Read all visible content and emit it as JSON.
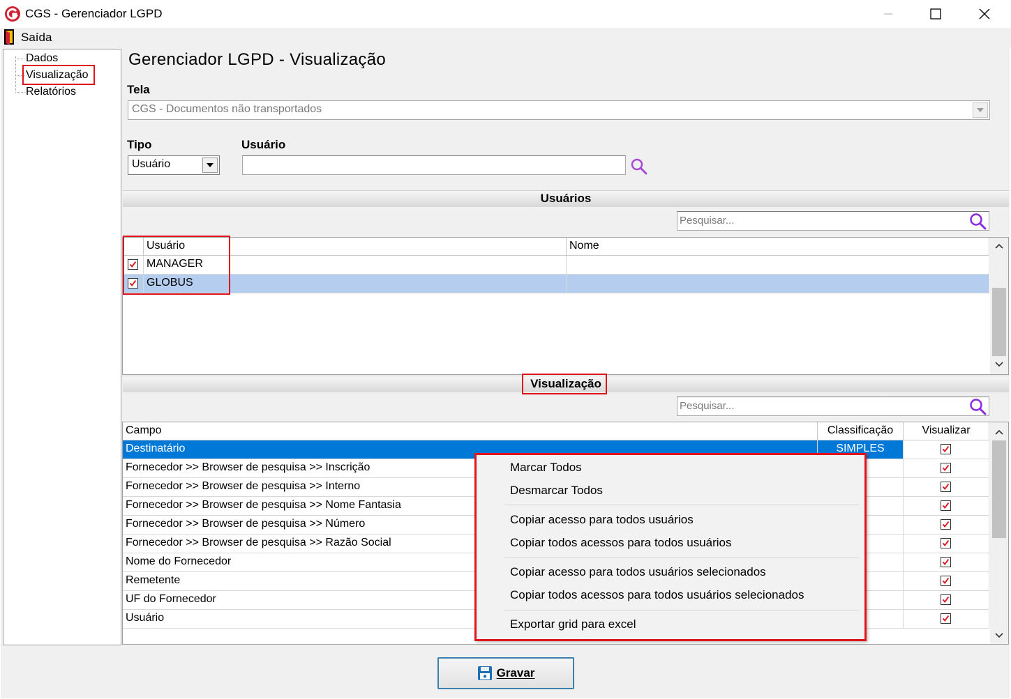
{
  "window": {
    "title": "CGS - Gerenciador LGPD",
    "minimize_label": "–",
    "maximize_label": "☐",
    "close_label": "✕"
  },
  "menu": {
    "exit_label": "Saída"
  },
  "tree": {
    "items": [
      {
        "label": "Dados"
      },
      {
        "label": "Visualização",
        "highlighted": true
      },
      {
        "label": "Relatórios"
      }
    ]
  },
  "page": {
    "title": "Gerenciador LGPD - Visualização",
    "tela_label": "Tela",
    "tela_value": "CGS - Documentos não transportados",
    "tipo_label": "Tipo",
    "tipo_value": "Usuário",
    "usuario_label": "Usuário",
    "usuario_value": ""
  },
  "users_section": {
    "title": "Usuários",
    "search_placeholder": "Pesquisar...",
    "columns": [
      "Usuário",
      "Nome"
    ],
    "rows": [
      {
        "checked": true,
        "usuario": "MANAGER",
        "nome": ""
      },
      {
        "checked": true,
        "usuario": "GLOBUS",
        "nome": "",
        "selected": true
      }
    ]
  },
  "view_section": {
    "title": "Visualização",
    "search_placeholder": "Pesquisar...",
    "columns": [
      "Campo",
      "Classificação",
      "Visualizar"
    ],
    "rows": [
      {
        "campo": "Destinatário",
        "classificacao": "SIMPLES",
        "visualizar": true,
        "selected": true
      },
      {
        "campo": "Fornecedor >> Browser de pesquisa >> Inscrição",
        "classificacao": "",
        "visualizar": true
      },
      {
        "campo": "Fornecedor >> Browser de pesquisa >> Interno",
        "classificacao": "",
        "visualizar": true
      },
      {
        "campo": "Fornecedor >> Browser de pesquisa >> Nome Fantasia",
        "classificacao": "",
        "visualizar": true
      },
      {
        "campo": "Fornecedor >> Browser de pesquisa >> Número",
        "classificacao": "",
        "visualizar": true
      },
      {
        "campo": "Fornecedor >> Browser de pesquisa >> Razão Social",
        "classificacao": "",
        "visualizar": true
      },
      {
        "campo": "Nome do Fornecedor",
        "classificacao": "",
        "visualizar": true
      },
      {
        "campo": "Remetente",
        "classificacao": "",
        "visualizar": true
      },
      {
        "campo": "UF do Fornecedor",
        "classificacao": "",
        "visualizar": true
      },
      {
        "campo": "Usuário",
        "classificacao": "",
        "visualizar": true
      }
    ]
  },
  "context_menu": {
    "groups": [
      [
        "Marcar Todos",
        "Desmarcar Todos"
      ],
      [
        "Copiar acesso para todos usuários",
        "Copiar todos acessos para todos usuários"
      ],
      [
        "Copiar acesso para todos usuários selecionados",
        "Copiar todos acessos para todos usuários selecionados"
      ],
      [
        "Exportar grid para excel"
      ]
    ]
  },
  "actions": {
    "save_label": "Gravar"
  },
  "colors": {
    "highlight_red": "#e0141c",
    "selected_row_blue": "#0078d7",
    "selected_row_light": "#b5cdee",
    "check_red": "#e0141c",
    "search_purple": "#8a2be2"
  },
  "icons": {
    "app": "cgs-logo-icon",
    "exit": "exit-door-icon",
    "search": "search-icon",
    "save": "floppy-disk-icon"
  }
}
